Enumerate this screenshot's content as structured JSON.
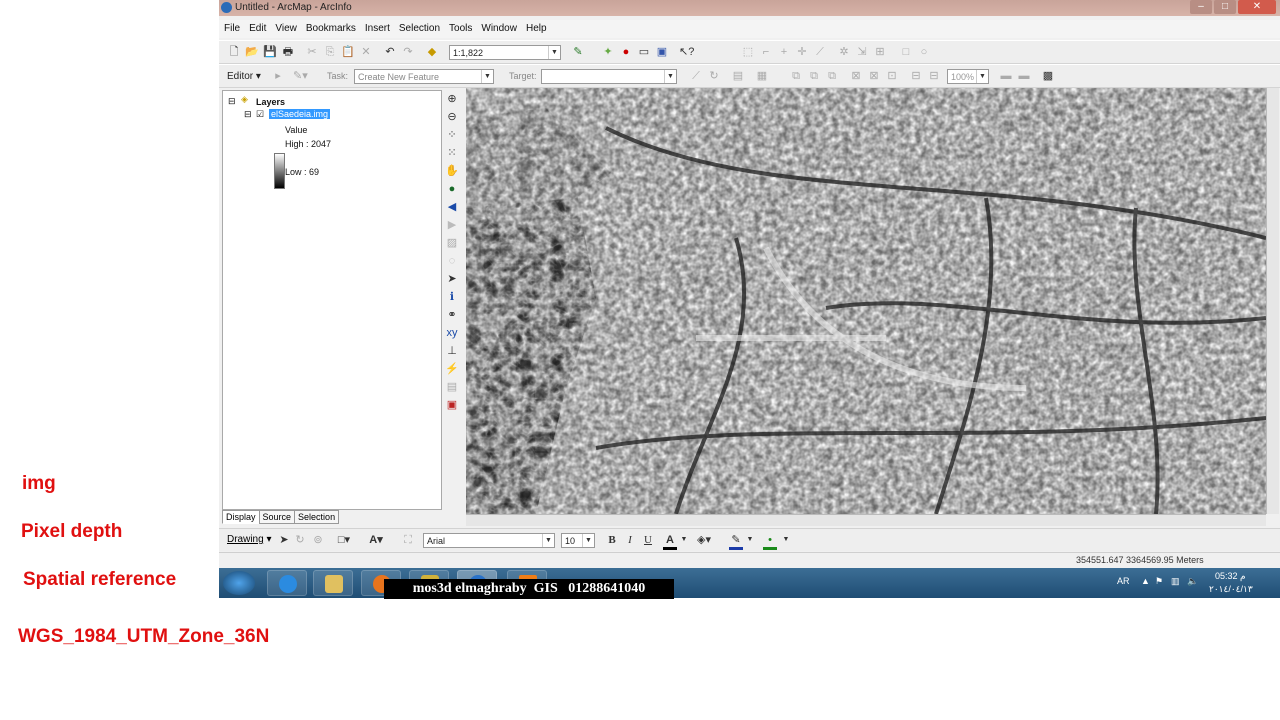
{
  "notes": {
    "img": "img",
    "pixel_depth": "Pixel depth",
    "spatial_reference": "Spatial reference",
    "projection": "WGS_1984_UTM_Zone_36N"
  },
  "window": {
    "title": "Untitled - ArcMap - ArcInfo"
  },
  "menu": [
    "File",
    "Edit",
    "View",
    "Bookmarks",
    "Insert",
    "Selection",
    "Tools",
    "Window",
    "Help"
  ],
  "toolbar": {
    "scale": "1:1,822",
    "editor_label": "Editor",
    "task_label": "Task:",
    "task_value": "Create New Feature",
    "target_label": "Target:",
    "zoom_value": "100%"
  },
  "toc": {
    "root": "Layers",
    "layer_name": "elSaedeia.img",
    "value_label": "Value",
    "high": "High : 2047",
    "low": "Low : 69",
    "tabs": [
      "Display",
      "Source",
      "Selection"
    ]
  },
  "drawing": {
    "label": "Drawing",
    "font": "Arial",
    "size": "10",
    "bold": "B",
    "italic": "I",
    "underline": "U",
    "font_color": "A",
    "text_tool": "A"
  },
  "status": {
    "coords": "354551.647  3364569.95 Meters"
  },
  "taskbar": {
    "banner": "mos3d elmaghraby  GIS   01288641040",
    "lang": "AR",
    "time": "05:32 م",
    "date": "٢٠١٤/٠٤/١٣"
  },
  "colors": {
    "note_red": "#e01010",
    "selected_layer": "#3399ff"
  }
}
